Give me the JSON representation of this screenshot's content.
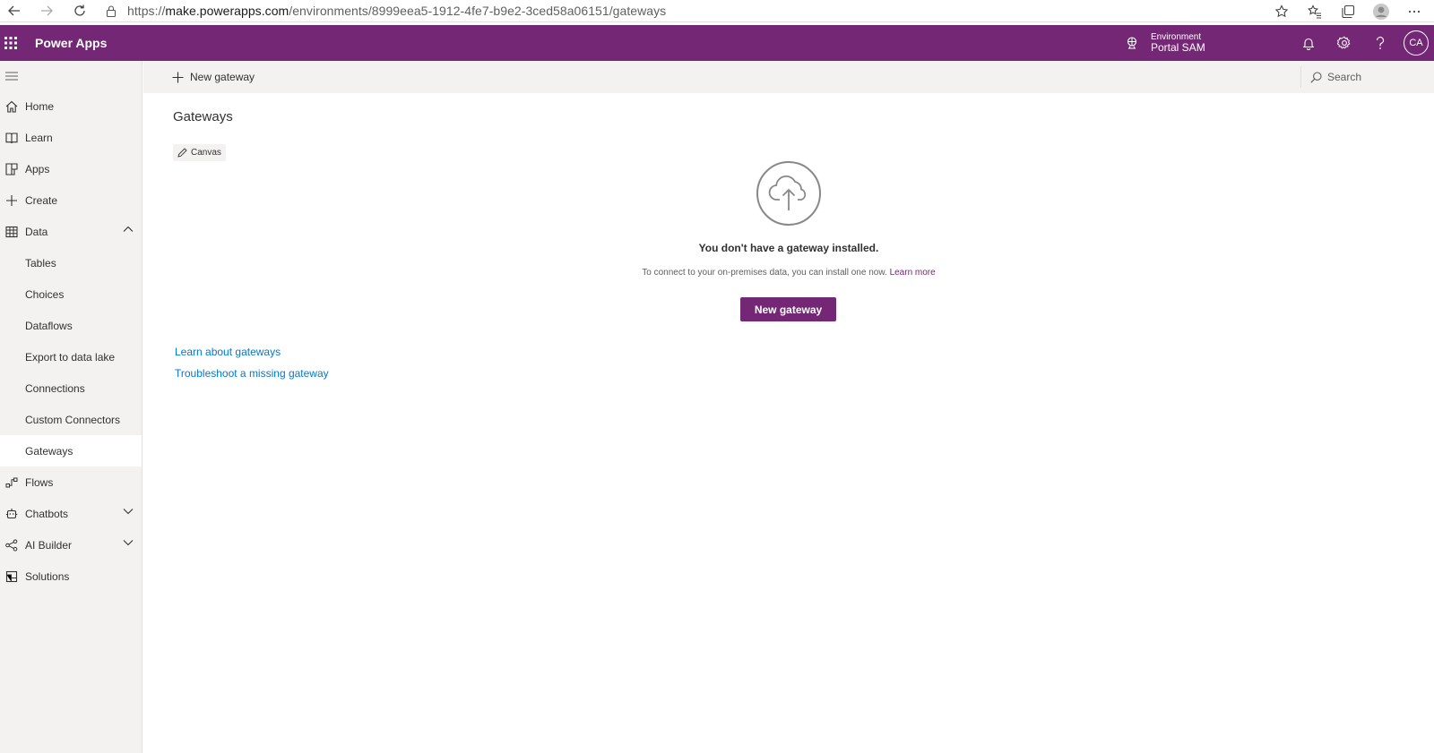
{
  "browser": {
    "url_scheme": "https://",
    "url_host": "make.powerapps.com",
    "url_path": "/environments/8999eea5-1912-4fe7-b9e2-3ced58a06151/gateways"
  },
  "header": {
    "app_name": "Power Apps",
    "environment_label": "Environment",
    "environment_name": "Portal SAM",
    "avatar_initials": "CA",
    "accent_color": "#742774"
  },
  "sidebar": {
    "items": [
      {
        "label": "Home",
        "icon": "home-icon"
      },
      {
        "label": "Learn",
        "icon": "book-icon"
      },
      {
        "label": "Apps",
        "icon": "apps-icon"
      },
      {
        "label": "Create",
        "icon": "plus-icon"
      },
      {
        "label": "Data",
        "icon": "table-icon",
        "expanded": true
      },
      {
        "label": "Tables"
      },
      {
        "label": "Choices"
      },
      {
        "label": "Dataflows"
      },
      {
        "label": "Export to data lake"
      },
      {
        "label": "Connections"
      },
      {
        "label": "Custom Connectors"
      },
      {
        "label": "Gateways",
        "active": true
      },
      {
        "label": "Flows",
        "icon": "flow-icon"
      },
      {
        "label": "Chatbots",
        "icon": "bot-icon",
        "expandable": true
      },
      {
        "label": "AI Builder",
        "icon": "ai-builder-icon",
        "expandable": true
      },
      {
        "label": "Solutions",
        "icon": "solutions-icon"
      }
    ]
  },
  "commandbar": {
    "new_gateway_label": "New gateway",
    "search_label": "Search"
  },
  "main": {
    "title": "Gateways",
    "pill_label": "Canvas",
    "empty_title": "You don't have a gateway installed.",
    "empty_desc": "To connect to your on-premises data, you can install one now.",
    "learn_more": "Learn more",
    "primary_button": "New gateway",
    "links": [
      "Learn about gateways",
      "Troubleshoot a missing gateway"
    ]
  }
}
